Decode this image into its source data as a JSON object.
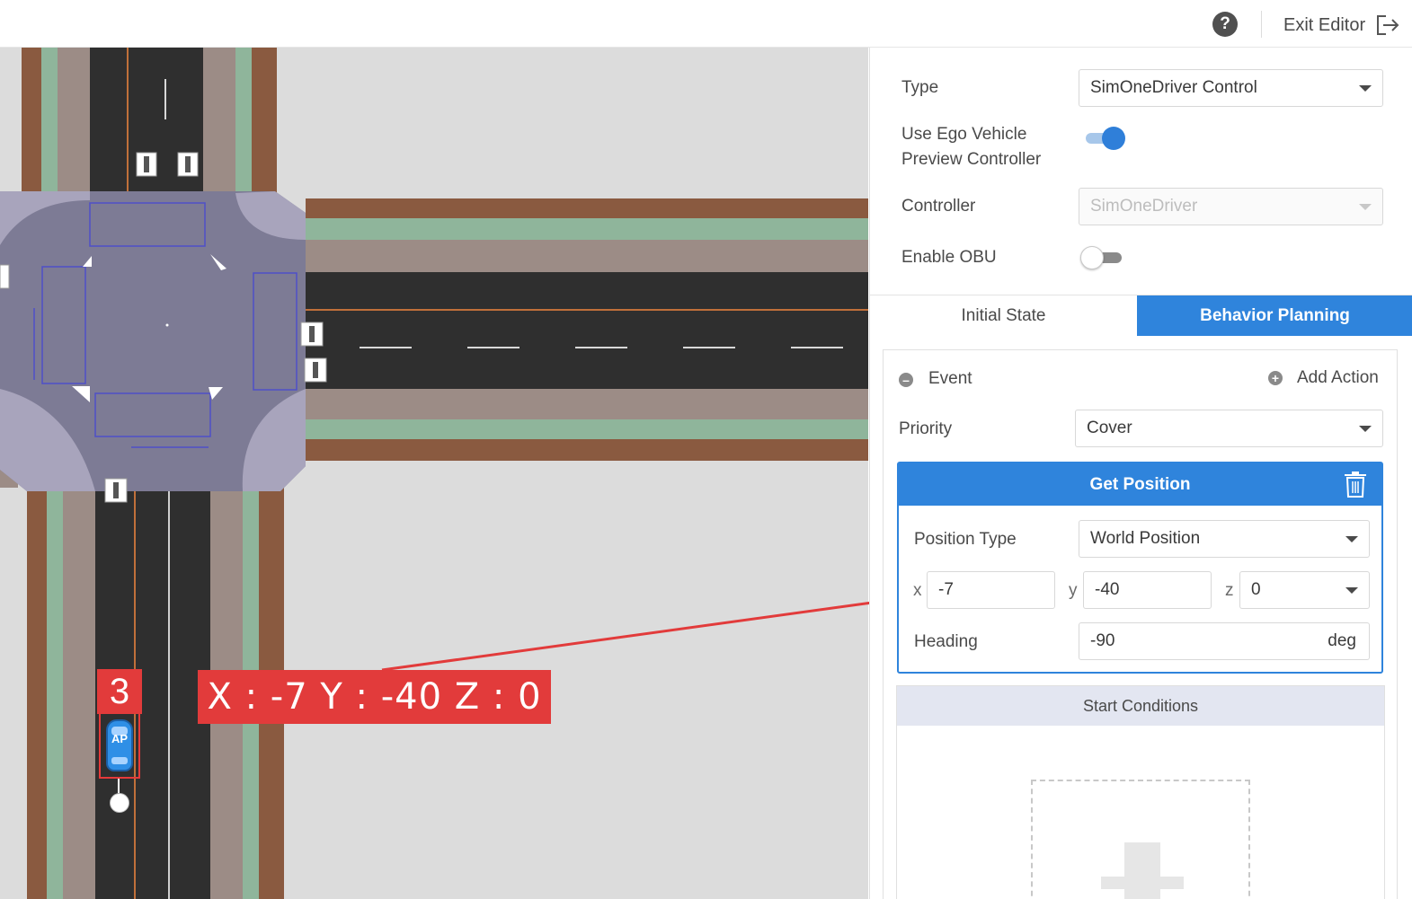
{
  "topbar": {
    "help_icon": "help-circle-icon",
    "exit_label": "Exit Editor",
    "exit_icon": "exit-icon"
  },
  "map": {
    "step_number": "3",
    "coord_readout": "X : -7 Y : -40 Z : 0",
    "vehicle_label": "AP",
    "colors": {
      "ground": "#dcdcdc",
      "asphalt": "#2f2f2f",
      "junction": "#7d7b95",
      "sidewalk": "#9c8c86",
      "curb_green": "#8fb59b",
      "curb_brown": "#8a5a40",
      "annotation_red": "#e23b3b",
      "vehicle_blue": "#2f8fe6"
    }
  },
  "panel": {
    "type_label": "Type",
    "type_value": "SimOneDriver Control",
    "ego_preview_label_line1": "Use Ego Vehicle",
    "ego_preview_label_line2": "Preview Controller",
    "ego_preview_on": true,
    "controller_label": "Controller",
    "controller_value": "SimOneDriver",
    "obu_label": "Enable OBU",
    "obu_on": false,
    "tabs": [
      {
        "label": "Initial State",
        "active": false
      },
      {
        "label": "Behavior Planning",
        "active": true
      }
    ],
    "event": {
      "event_label": "Event",
      "add_action_label": "Add Action",
      "priority_label": "Priority",
      "priority_value": "Cover",
      "action_card": {
        "title": "Get Position",
        "position_type_label": "Position Type",
        "position_type_value": "World Position",
        "x_label": "x",
        "x_value": "-7",
        "y_label": "y",
        "y_value": "-40",
        "z_label": "z",
        "z_value": "0",
        "heading_label": "Heading",
        "heading_value": "-90",
        "heading_unit": "deg"
      },
      "start_conditions_label": "Start Conditions"
    },
    "accent_color": "#2f84dc"
  }
}
